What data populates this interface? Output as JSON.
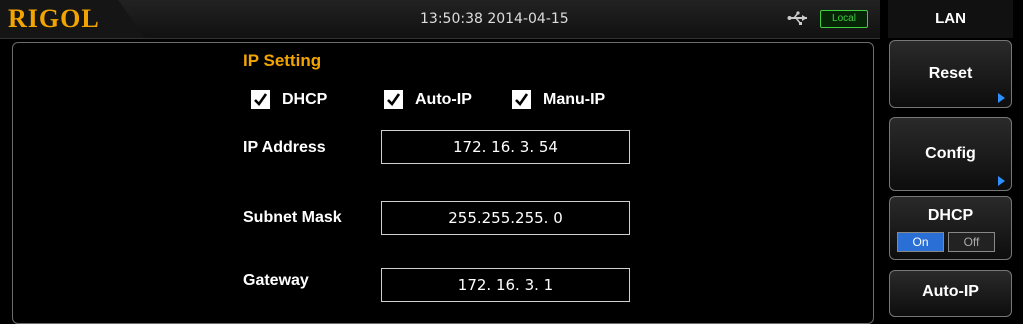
{
  "header": {
    "logo": "RIGOL",
    "datetime": "13:50:38 2014-04-15",
    "usb_icon": "usb-icon",
    "status_badge": "Local"
  },
  "ip_setting": {
    "title": "IP Setting",
    "checkboxes": [
      {
        "label": "DHCP",
        "checked": true
      },
      {
        "label": "Auto-IP",
        "checked": true
      },
      {
        "label": "Manu-IP",
        "checked": true
      }
    ],
    "fields": [
      {
        "label": "IP Address",
        "value": "172. 16. 3. 54"
      },
      {
        "label": "Subnet Mask",
        "value": "255.255.255. 0"
      },
      {
        "label": "Gateway",
        "value": "172. 16. 3. 1"
      }
    ]
  },
  "sidebar": {
    "title": "LAN",
    "reset_label": "Reset",
    "config_label": "Config",
    "dhcp": {
      "label": "DHCP",
      "on": "On",
      "off": "Off",
      "state": "On"
    },
    "autoip_label": "Auto-IP"
  },
  "colors": {
    "accent": "#f2a400",
    "active": "#2a6fd6",
    "badge": "#3fcf3f"
  }
}
